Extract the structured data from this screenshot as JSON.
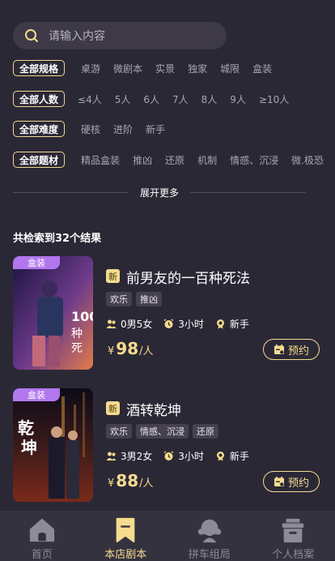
{
  "search": {
    "placeholder": "请输入内容"
  },
  "filters": [
    {
      "label": "全部规格",
      "options": [
        "桌游",
        "微剧本",
        "实景",
        "独家",
        "城限",
        "盒装"
      ]
    },
    {
      "label": "全部人数",
      "options": [
        "≤4人",
        "5人",
        "6人",
        "7人",
        "8人",
        "9人",
        "≥10人"
      ]
    },
    {
      "label": "全部难度",
      "options": [
        "硬核",
        "进阶",
        "新手"
      ]
    },
    {
      "label": "全部题材",
      "options": [
        "精品盒装",
        "推凶",
        "还原",
        "机制",
        "情感、沉浸",
        "微.极恐"
      ]
    }
  ],
  "more_label": "展开更多",
  "result_count": "共检索到32个结果",
  "cards": [
    {
      "cover_tag": "盒装",
      "new_label": "新",
      "title": "前男友的一百种死法",
      "tags": [
        "欢乐",
        "推凶"
      ],
      "players": "0男5女",
      "duration": "3小时",
      "level": "新手",
      "currency": "¥",
      "price": "98",
      "unit": "/人",
      "book_label": "预约",
      "cover_colors": [
        "#1a1440",
        "#b2528a",
        "#e27c4a"
      ]
    },
    {
      "cover_tag": "盒装",
      "new_label": "新",
      "title": "酒转乾坤",
      "tags": [
        "欢乐",
        "情感、沉浸",
        "还原"
      ],
      "players": "3男2女",
      "duration": "3小时",
      "level": "新手",
      "currency": "¥",
      "price": "88",
      "unit": "/人",
      "book_label": "预约",
      "cover_colors": [
        "#0d0b18",
        "#7a2a1a",
        "#d9a042"
      ]
    }
  ],
  "tabs": [
    {
      "label": "首页",
      "icon": "home-icon",
      "active": false
    },
    {
      "label": "本店剧本",
      "icon": "bookmark-icon",
      "active": true
    },
    {
      "label": "拼车组局",
      "icon": "group-icon",
      "active": false
    },
    {
      "label": "个人档案",
      "icon": "archive-icon",
      "active": false
    }
  ],
  "colors": {
    "accent": "#f5dc8e",
    "background": "#2b2836",
    "tag_purple": "#b277ee"
  }
}
